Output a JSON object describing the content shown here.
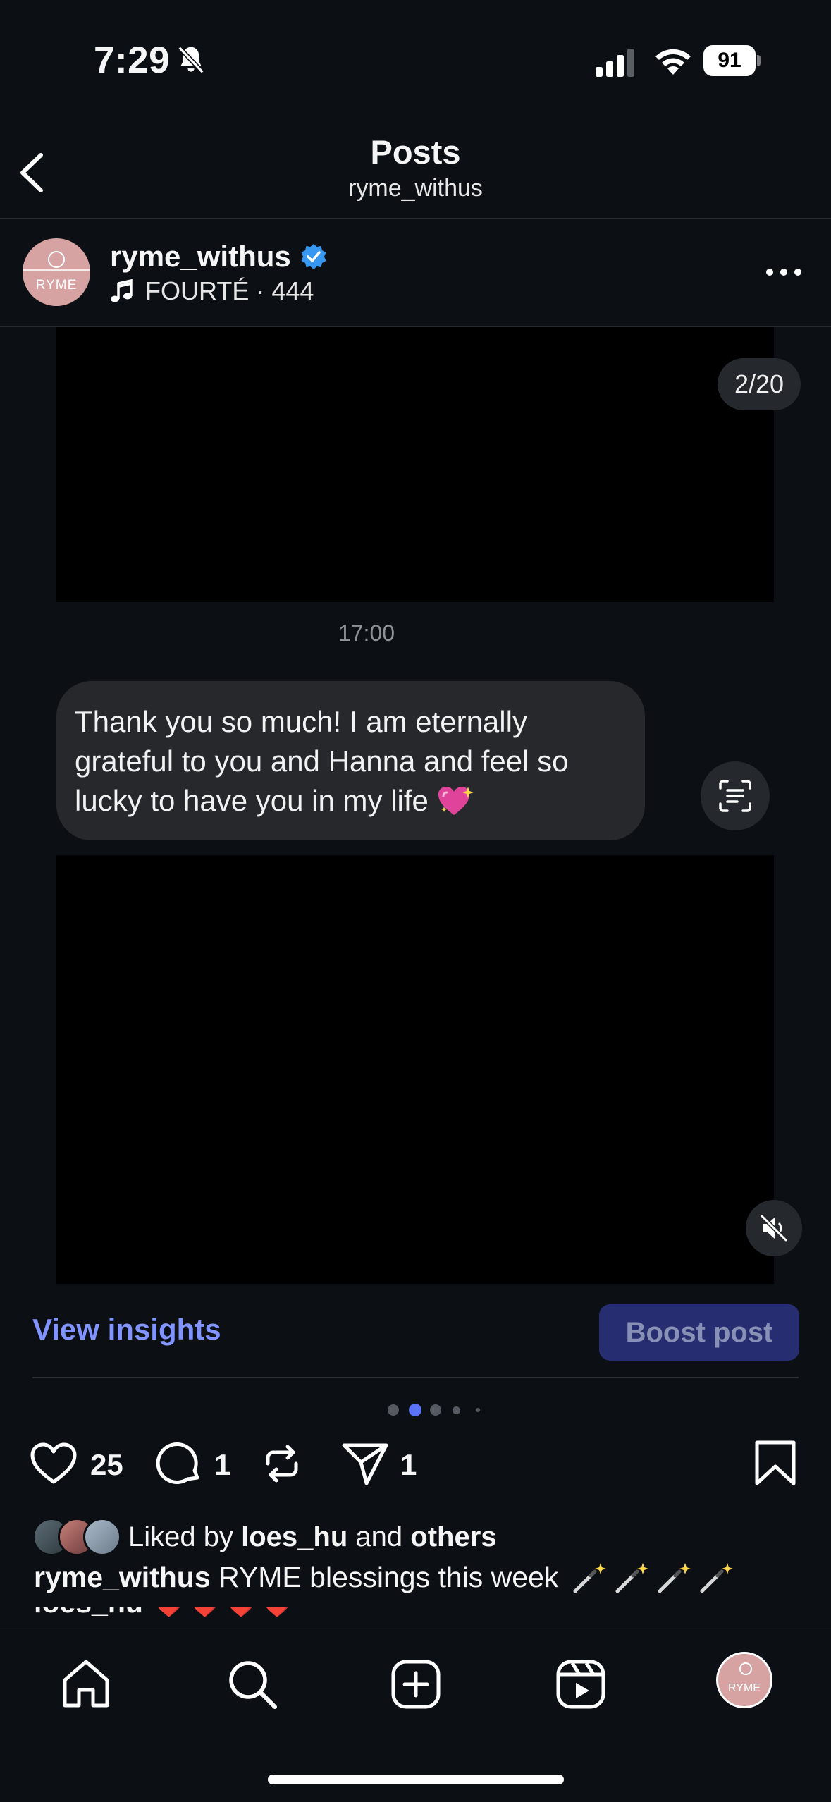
{
  "status_bar": {
    "time": "7:29",
    "battery": "91"
  },
  "nav": {
    "title": "Posts",
    "subtitle": "ryme_withus"
  },
  "post": {
    "username": "ryme_withus",
    "avatar_label": "RYME",
    "audio": "FOURTÉ · 444",
    "counter": "2/20"
  },
  "content": {
    "timestamp": "17:00",
    "message": "Thank you so much! I am eternally grateful to you and Hanna and feel so lucky to have you in my life"
  },
  "insights": {
    "view_label": "View insights",
    "boost_label": "Boost post"
  },
  "carousel": {
    "total_dots": 5,
    "active_index": 1
  },
  "actions": {
    "likes": "25",
    "comments": "1",
    "shares": "1"
  },
  "liked_by": {
    "prefix": "Liked by",
    "user": "loes_hu",
    "conj": "and",
    "others": "others"
  },
  "caption": {
    "user": "ryme_withus",
    "text": "RYME blessings this week"
  },
  "comment_peek": {
    "user": "loes_hu",
    "text": "❤️❤️❤️❤️"
  },
  "colors": {
    "accent": "#8193ff",
    "boost_bg": "#262e71",
    "background": "#0c1014"
  }
}
